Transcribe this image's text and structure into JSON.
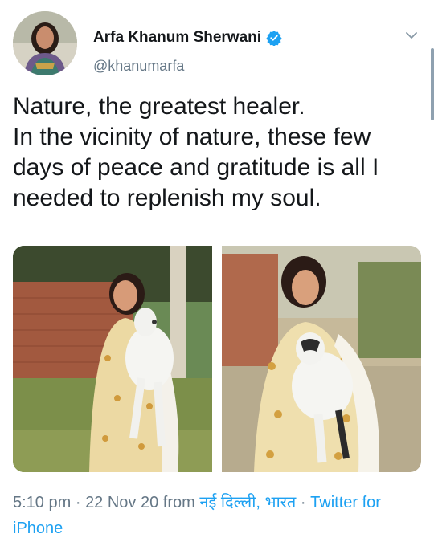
{
  "tweet": {
    "author_name": "Arfa Khanum Sherwani",
    "author_handle": "@khanumarfa",
    "text": "Nature, the greatest healer.\nIn the vicinity of nature, these few days of peace and gratitude is all I needed to replenish my soul.",
    "time": "5:10 pm",
    "date": "22 Nov 20",
    "from_word": "from",
    "location": "नई दिल्ली, भारत",
    "source": "Twitter for iPhone",
    "separator": "·"
  },
  "icons": {
    "verified": "verified-badge-icon",
    "menu": "chevron-down-icon"
  },
  "colors": {
    "link": "#1da1f2",
    "secondary_text": "#657786",
    "primary_text": "#14171a"
  }
}
